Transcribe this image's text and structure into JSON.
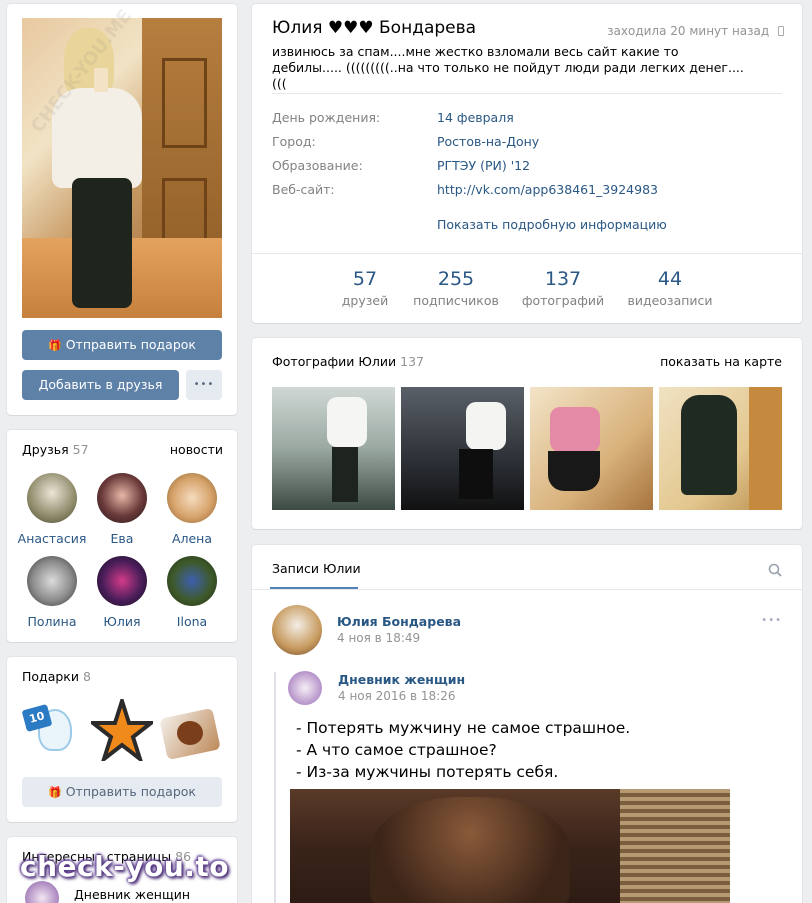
{
  "profile": {
    "name": "Юлия ♥♥♥ Бондарева",
    "last_seen": "заходила 20 минут назад",
    "status": "извинюсь за спам....мне жестко взломали весь сайт какие то дебилы..... (((((((((..на что только не пойдут люди ради легких денег....(((",
    "info": [
      {
        "label": "День рождения:",
        "value": "14 февраля"
      },
      {
        "label": "Город:",
        "value": "Ростов-на-Дону"
      },
      {
        "label": "Образование:",
        "value": "РГТЭУ (РИ) '12"
      },
      {
        "label": "Веб-сайт:",
        "value": "http://vk.com/app638461_3924983"
      }
    ],
    "more_info": "Показать подробную информацию",
    "stats": [
      {
        "num": "57",
        "label": "друзей"
      },
      {
        "num": "255",
        "label": "подписчиков"
      },
      {
        "num": "137",
        "label": "фотографий"
      },
      {
        "num": "44",
        "label": "видеозаписи"
      }
    ]
  },
  "actions": {
    "send_gift": "Отправить подарок",
    "add_friend": "Добавить в друзья",
    "more": "•••"
  },
  "friends": {
    "title": "Друзья",
    "count": "57",
    "news_link": "новости",
    "items": [
      {
        "name": "Анастасия"
      },
      {
        "name": "Ева"
      },
      {
        "name": "Алена"
      },
      {
        "name": "Полина"
      },
      {
        "name": "Юлия"
      },
      {
        "name": "Ilona"
      }
    ]
  },
  "gifts": {
    "title": "Подарки",
    "count": "8",
    "send_gift": "Отправить подарок"
  },
  "pages": {
    "title": "Интересные страницы",
    "count": "86",
    "item": "Дневник женщин"
  },
  "photos": {
    "title": "Фотографии Юлии",
    "count": "137",
    "map_link": "показать на карте"
  },
  "wall": {
    "tab": "Записи Юлии",
    "post": {
      "author": "Юлия Бондарева",
      "date": "4 ноя в 18:49",
      "repost_author": "Дневник женщин",
      "repost_date": "4 ноя 2016 в 18:26",
      "lines": [
        "- Потерять мужчину не самое страшное.",
        "- А что самое страшное?",
        "- Из-за мужчины потерять себя."
      ]
    }
  },
  "branding": {
    "overlay": "check-you.to",
    "watermark": "CHECK-YOU.ME"
  },
  "icons": [
    "gift-icon",
    "search-icon",
    "more-icon",
    "phone-icon"
  ]
}
